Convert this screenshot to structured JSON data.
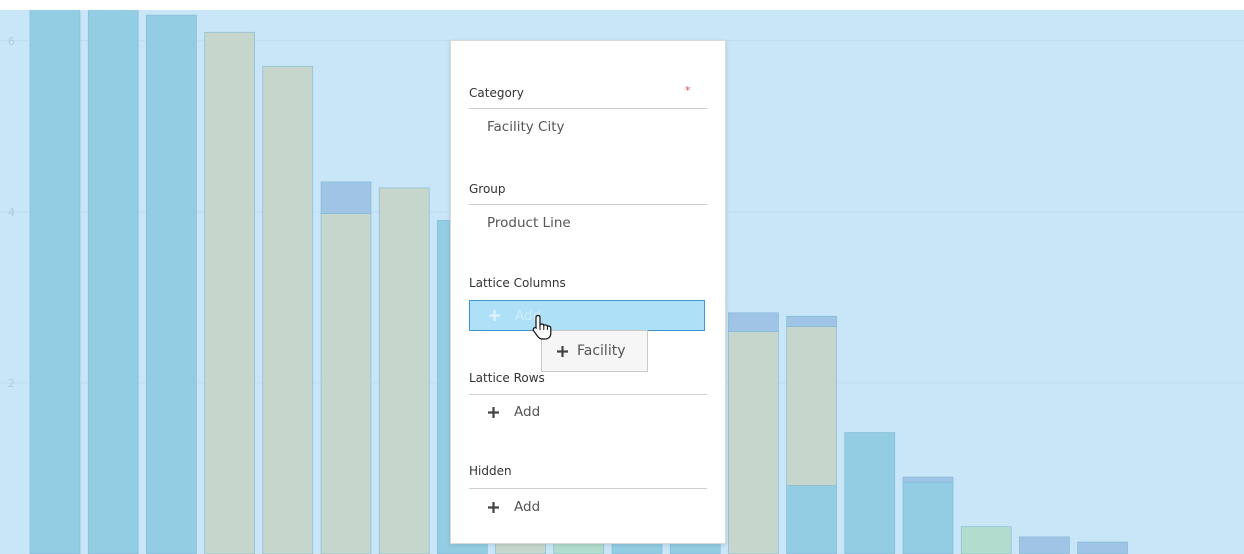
{
  "chart_data": {
    "type": "bar",
    "ylim": [
      0,
      6.5
    ],
    "yticks": [
      2,
      4,
      6
    ],
    "grid": true,
    "bars": [
      {
        "total": 6.6,
        "segments": [
          {
            "v": 6.6,
            "c": "#93cde3"
          }
        ]
      },
      {
        "total": 6.5,
        "segments": [
          {
            "v": 6.5,
            "c": "#93cde3"
          }
        ]
      },
      {
        "total": 6.3,
        "segments": [
          {
            "v": 6.3,
            "c": "#93cde3"
          }
        ]
      },
      {
        "total": 6.1,
        "segments": [
          {
            "v": 6.1,
            "c": "#c6d6cc"
          }
        ]
      },
      {
        "total": 5.7,
        "segments": [
          {
            "v": 5.7,
            "c": "#c6d6cc"
          }
        ]
      },
      {
        "total": 4.35,
        "segments": [
          {
            "v": 3.98,
            "c": "#c6d6cc"
          },
          {
            "v": 0.37,
            "c": "#9fc4e6"
          }
        ]
      },
      {
        "total": 4.28,
        "segments": [
          {
            "v": 4.28,
            "c": "#c6d6cc"
          }
        ]
      },
      {
        "total": 3.9,
        "segments": [
          {
            "v": 3.9,
            "c": "#93cde3"
          }
        ]
      },
      {
        "total": 2.0,
        "segments": [
          {
            "v": 2.0,
            "c": "#c6d6cc"
          }
        ]
      },
      {
        "total": 1.5,
        "segments": [
          {
            "v": 1.5,
            "c": "#b2dccd"
          }
        ]
      },
      {
        "total": 2.2,
        "segments": [
          {
            "v": 2.2,
            "c": "#93cde3"
          }
        ]
      },
      {
        "total": 2.5,
        "segments": [
          {
            "v": 2.5,
            "c": "#93cde3"
          }
        ]
      },
      {
        "total": 2.82,
        "segments": [
          {
            "v": 2.6,
            "c": "#c6d6cc"
          },
          {
            "v": 0.22,
            "c": "#9fc4e6"
          }
        ]
      },
      {
        "total": 2.78,
        "segments": [
          {
            "v": 0.8,
            "c": "#93cde3"
          },
          {
            "v": 1.86,
            "c": "#c6d6cc"
          },
          {
            "v": 0.12,
            "c": "#9fc4e6"
          }
        ]
      },
      {
        "total": 1.42,
        "segments": [
          {
            "v": 1.42,
            "c": "#93cde3"
          }
        ]
      },
      {
        "total": 0.9,
        "segments": [
          {
            "v": 0.84,
            "c": "#93cde3"
          },
          {
            "v": 0.06,
            "c": "#9fc4e6"
          }
        ]
      },
      {
        "total": 0.32,
        "segments": [
          {
            "v": 0.32,
            "c": "#b2dccd"
          }
        ]
      },
      {
        "total": 0.2,
        "segments": [
          {
            "v": 0.2,
            "c": "#9fc4e6"
          }
        ]
      },
      {
        "total": 0.14,
        "segments": [
          {
            "v": 0.14,
            "c": "#9fc4e6"
          }
        ]
      }
    ]
  },
  "roles_panel": {
    "category": {
      "title": "Category",
      "required_mark": "*",
      "value": "Facility City"
    },
    "group": {
      "title": "Group",
      "value": "Product Line"
    },
    "lattice_columns": {
      "title": "Lattice Columns",
      "add_label": "Add"
    },
    "lattice_rows": {
      "title": "Lattice Rows",
      "add_label": "Add"
    },
    "hidden": {
      "title": "Hidden",
      "add_label": "Add"
    }
  },
  "drag_ghost": {
    "label": "Facility"
  },
  "icons": {
    "plus": "plus-icon",
    "cursor": "hand-pointer-cursor-icon"
  }
}
